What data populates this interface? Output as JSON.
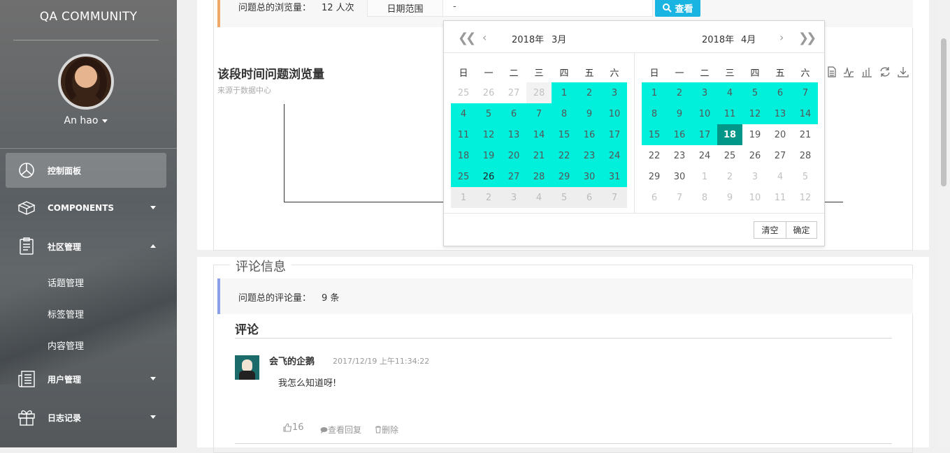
{
  "sidebar": {
    "brand": "QA COMMUNITY",
    "user_name": "An hao",
    "nav": [
      {
        "label": "控制面板",
        "icon": "pie-chart-icon"
      },
      {
        "label": "COMPONENTS",
        "icon": "cube-icon"
      },
      {
        "label": "社区管理",
        "icon": "clipboard-icon"
      },
      {
        "label": "用户管理",
        "icon": "newspaper-icon"
      },
      {
        "label": "日志记录",
        "icon": "gift-icon"
      }
    ],
    "community_sub": [
      "话题管理",
      "标签管理",
      "内容管理"
    ]
  },
  "views": {
    "summary_label": "问题总的浏览量：",
    "summary_value": "12 人次",
    "date_range_label": "日期范围",
    "date_range_value": "-",
    "search_button": "查看",
    "chart_title": "该段时间问题浏览量",
    "chart_subtitle": "来源于数据中心"
  },
  "calendar": {
    "left_year": "2018年",
    "left_month": "3月",
    "right_year": "2018年",
    "right_month": "4月",
    "weekdays": [
      "日",
      "一",
      "二",
      "三",
      "四",
      "五",
      "六"
    ],
    "clear_button": "清空",
    "confirm_button": "确定",
    "left_days": [
      [
        "25",
        "26",
        "27",
        "28",
        "1",
        "2",
        "3"
      ],
      [
        "4",
        "5",
        "6",
        "7",
        "8",
        "9",
        "10"
      ],
      [
        "11",
        "12",
        "13",
        "14",
        "15",
        "16",
        "17"
      ],
      [
        "18",
        "19",
        "20",
        "21",
        "22",
        "23",
        "24"
      ],
      [
        "25",
        "26",
        "27",
        "28",
        "29",
        "30",
        "31"
      ],
      [
        "1",
        "2",
        "3",
        "4",
        "5",
        "6",
        "7"
      ]
    ],
    "right_days": [
      [
        "1",
        "2",
        "3",
        "4",
        "5",
        "6",
        "7"
      ],
      [
        "8",
        "9",
        "10",
        "11",
        "12",
        "13",
        "14"
      ],
      [
        "15",
        "16",
        "17",
        "18",
        "19",
        "20",
        "21"
      ],
      [
        "22",
        "23",
        "24",
        "25",
        "26",
        "27",
        "28"
      ],
      [
        "29",
        "30",
        "1",
        "2",
        "3",
        "4",
        "5"
      ],
      [
        "6",
        "7",
        "8",
        "9",
        "10",
        "11",
        "12"
      ]
    ]
  },
  "comments": {
    "legend": "评论信息",
    "summary_label": "问题总的评论量：",
    "summary_value": "9 条",
    "section_title": "评论",
    "items": [
      {
        "author": "会飞的企鹅",
        "time": "2017/12/19 上午11:34:22",
        "text": "我怎么知道呀!",
        "likes": "16",
        "view_replies": "查看回复",
        "delete": "删除"
      }
    ]
  }
}
